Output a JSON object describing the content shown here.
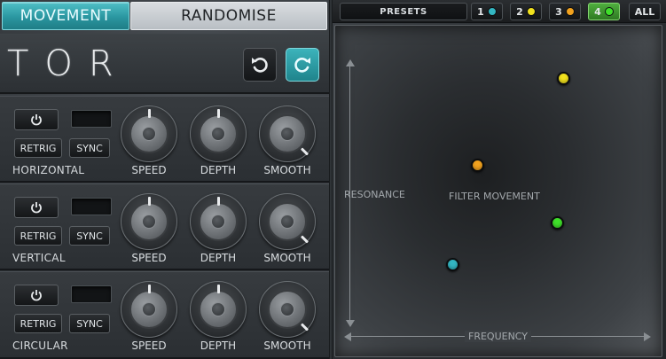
{
  "mode_tabs": {
    "movement": "MOVEMENT",
    "randomise": "RANDOMISE",
    "active": "movement"
  },
  "header": {
    "logo": "TOR",
    "undo_icon": "undo-icon",
    "redo_icon": "redo-icon"
  },
  "sections": [
    {
      "name": "HORIZONTAL",
      "power_icon": "power-icon",
      "retrig_label": "RETRIG",
      "sync_label": "SYNC",
      "knobs": {
        "speed": "SPEED",
        "depth": "DEPTH",
        "smooth": "SMOOTH"
      }
    },
    {
      "name": "VERTICAL",
      "power_icon": "power-icon",
      "retrig_label": "RETRIG",
      "sync_label": "SYNC",
      "knobs": {
        "speed": "SPEED",
        "depth": "DEPTH",
        "smooth": "SMOOTH"
      }
    },
    {
      "name": "CIRCULAR",
      "power_icon": "power-icon",
      "retrig_label": "RETRIG",
      "sync_label": "SYNC",
      "knobs": {
        "speed": "SPEED",
        "depth": "DEPTH",
        "smooth": "SMOOTH"
      }
    }
  ],
  "presets": {
    "label": "PRESETS",
    "slots": [
      {
        "number": "1",
        "color": "#33b6c2",
        "active": false
      },
      {
        "number": "2",
        "color": "#f2e21e",
        "active": false
      },
      {
        "number": "3",
        "color": "#f2a21e",
        "active": false
      },
      {
        "number": "4",
        "color": "#3fe02a",
        "active": true
      }
    ],
    "all_label": "ALL"
  },
  "xy_pad": {
    "y_axis_label": "RESONANCE",
    "x_axis_label": "FREQUENCY",
    "center_label": "FILTER MOVEMENT"
  },
  "colors": {
    "accent": "#2a96a0",
    "slot_1": "#33b6c2",
    "slot_2": "#f2e21e",
    "slot_3": "#f2a21e",
    "slot_4": "#3fe02a"
  }
}
